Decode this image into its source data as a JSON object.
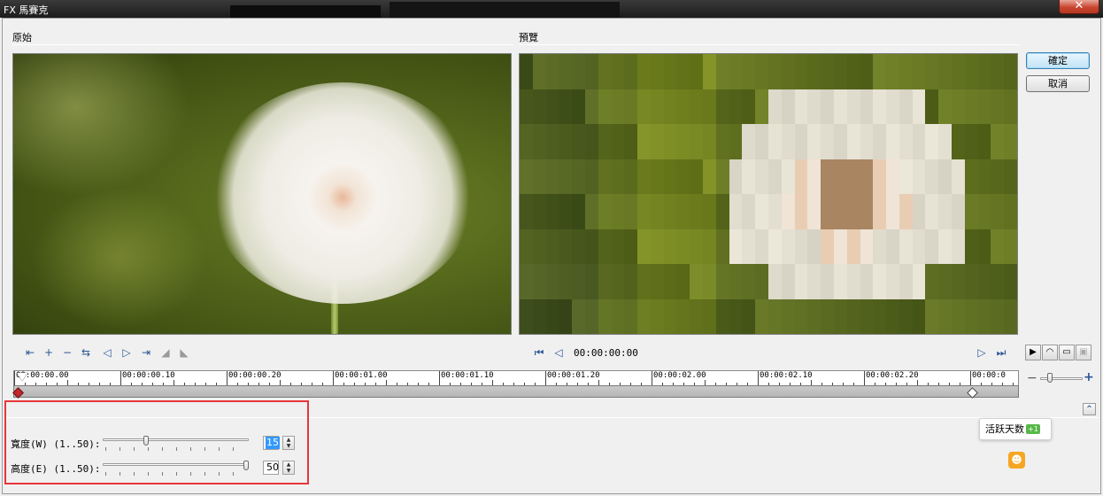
{
  "window": {
    "title": "FX 馬賽克",
    "close_glyph": "✕"
  },
  "panels": {
    "original_label": "原始",
    "preview_label": "預覽"
  },
  "buttons": {
    "ok": "確定",
    "cancel": "取消"
  },
  "left_toolbar": [
    {
      "icon": "go-to-start-icon",
      "glyph": "⇤"
    },
    {
      "icon": "add-keyframe-icon",
      "glyph": "+"
    },
    {
      "icon": "remove-keyframe-icon",
      "glyph": "−"
    },
    {
      "icon": "reverse-keyframes-icon",
      "glyph": "⇆"
    },
    {
      "icon": "previous-keyframe-icon",
      "glyph": "◁"
    },
    {
      "icon": "next-keyframe-icon",
      "glyph": "▷"
    },
    {
      "icon": "go-to-end-icon",
      "glyph": "⇥"
    },
    {
      "icon": "move-left-icon",
      "glyph": "◢"
    },
    {
      "icon": "move-right-icon",
      "glyph": "◣"
    }
  ],
  "playback": {
    "timecode": "00:00:00:00",
    "first_glyph": "⏮",
    "prev_glyph": "◁",
    "next_glyph": "▷",
    "last_glyph": "⏭"
  },
  "ruler": {
    "labels": [
      "00:00:00.00",
      "00:00:00.10",
      "00:00:00.20",
      "00:00:01.00",
      "00:00:01.10",
      "00:00:01.20",
      "00:00:02.00",
      "00:00:02.10",
      "00:00:02.20",
      "00:00:0"
    ]
  },
  "right_controls": {
    "play_glyph": "▶",
    "zoom_minus": "−",
    "zoom_plus": "+",
    "expand_glyph": "⌃"
  },
  "params": {
    "width_label": "寬度(W) (1..50):",
    "width_value": "15",
    "width_fraction": 0.29,
    "height_label": "高度(E) (1..50):",
    "height_value": "50",
    "height_fraction": 1.0
  },
  "tooltip": {
    "text": "活跃天数",
    "badge": "+1"
  },
  "colors": {
    "accent": "#3c7fb1",
    "highlight_box": "#e8363c",
    "keyframe": "#c0282e"
  }
}
